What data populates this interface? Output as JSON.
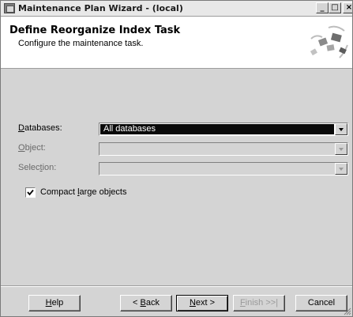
{
  "window": {
    "title": "Maintenance Plan Wizard - (local)",
    "controls": {
      "minimize": "_",
      "maximize": "□",
      "close": "×"
    }
  },
  "header": {
    "title": "Define Reorganize Index Task",
    "subtitle": "Configure the maintenance task.",
    "graphic_icon": "wizard-banner-icon"
  },
  "form": {
    "databases": {
      "label": "Databases:",
      "value": "All databases",
      "enabled": true
    },
    "object": {
      "label": "Object:",
      "value": "",
      "enabled": false
    },
    "selection": {
      "label": "Selection:",
      "value": "",
      "enabled": false
    },
    "compact": {
      "label": "Compact large objects",
      "checked": true
    }
  },
  "footer": {
    "help": "Help",
    "back": "< Back",
    "next": "Next >",
    "finish": "Finish >>|",
    "cancel": "Cancel"
  },
  "colors": {
    "dialog_bg": "#d4d4d4",
    "header_bg": "#ffffff",
    "selected_bg": "#0a0a0a"
  }
}
